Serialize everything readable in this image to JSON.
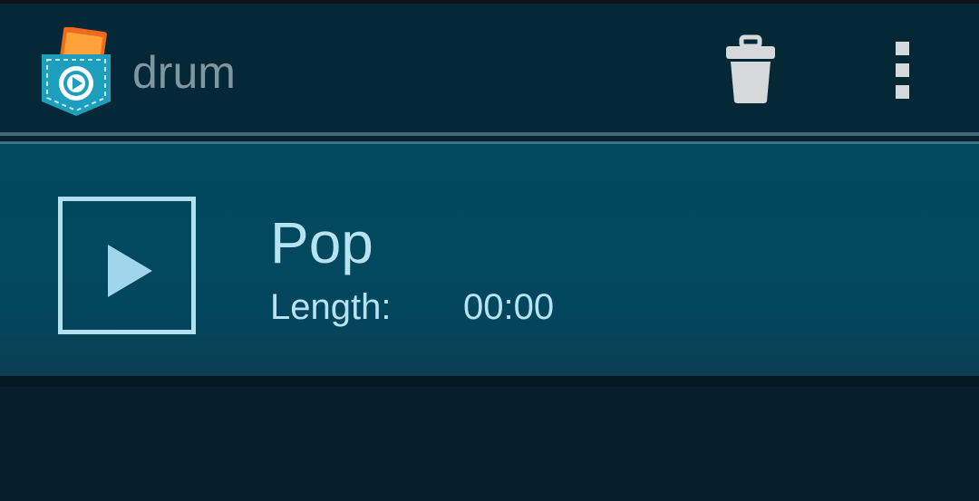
{
  "app": {
    "title": "drum",
    "icon": "pocket-video-app-icon"
  },
  "actions": {
    "delete_icon": "trash-icon",
    "overflow_icon": "overflow-menu-icon"
  },
  "list": {
    "items": [
      {
        "title": "Pop",
        "length_label": "Length:",
        "length_value": "00:00",
        "play_icon": "play-icon"
      }
    ]
  },
  "colors": {
    "action_bar": "#052837",
    "list_item": "#00495f",
    "text_light": "#b6e2f1",
    "title_muted": "#7e98a3",
    "background": "#06202b"
  }
}
